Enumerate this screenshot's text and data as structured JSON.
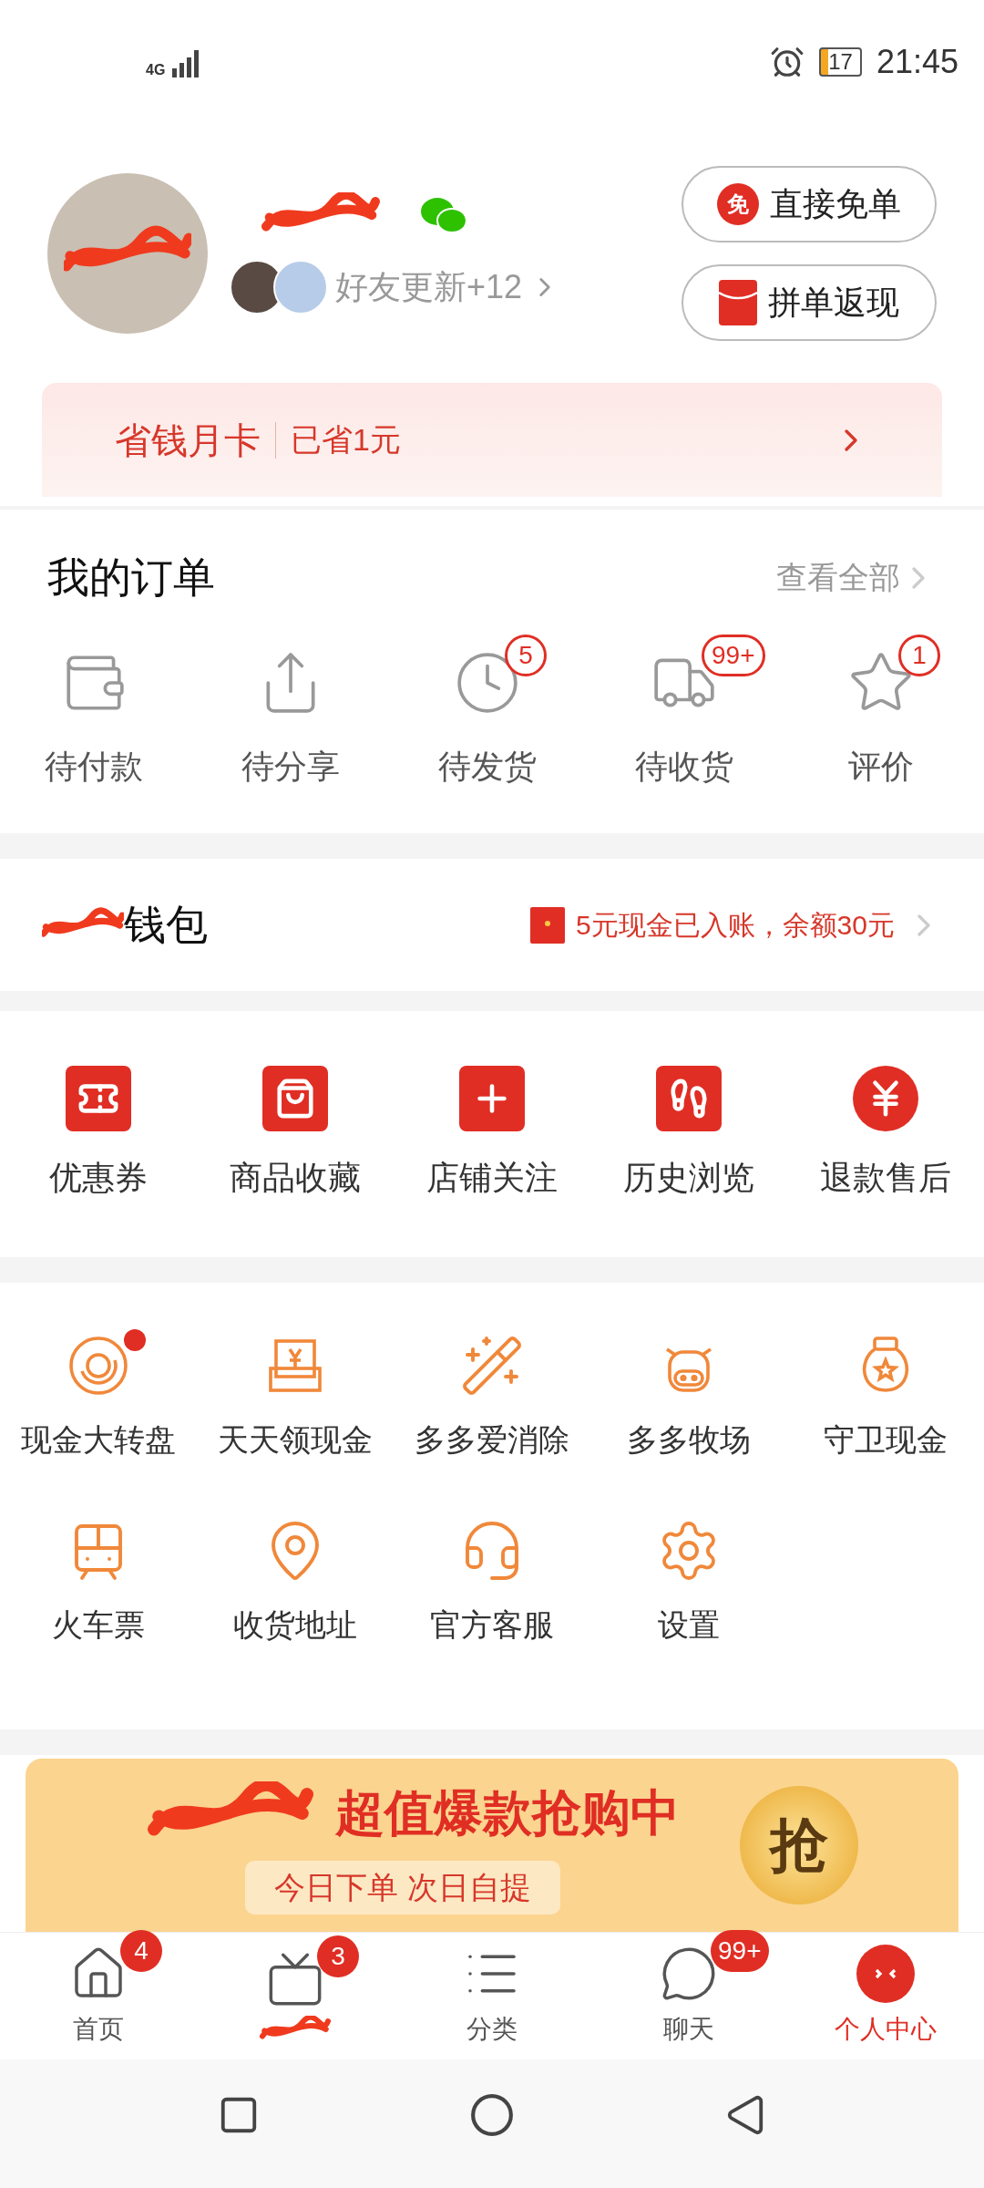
{
  "status_bar": {
    "time": "21:45",
    "battery": "17",
    "network": "4G"
  },
  "profile": {
    "friends_update": "好友更新+12",
    "buttons": [
      {
        "label": "直接免单",
        "badge": "免"
      },
      {
        "label": "拼单返现"
      }
    ]
  },
  "savings_card": {
    "title": "省钱月卡",
    "saved": "已省1元"
  },
  "orders": {
    "title": "我的订单",
    "view_all": "查看全部",
    "items": [
      {
        "label": "待付款"
      },
      {
        "label": "待分享"
      },
      {
        "label": "待发货",
        "count": "5"
      },
      {
        "label": "待收货",
        "count": "99+"
      },
      {
        "label": "评价",
        "count": "1"
      }
    ]
  },
  "wallet": {
    "title": "钱包",
    "notice": "5元现金已入账，余额30元"
  },
  "shortcuts": [
    {
      "label": "优惠券"
    },
    {
      "label": "商品收藏"
    },
    {
      "label": "店铺关注"
    },
    {
      "label": "历史浏览"
    },
    {
      "label": "退款售后"
    }
  ],
  "tools": [
    {
      "label": "现金大转盘",
      "dot": true
    },
    {
      "label": "天天领现金",
      "dot": false
    },
    {
      "label": "多多爱消除",
      "dot": false
    },
    {
      "label": "多多牧场",
      "dot": false
    },
    {
      "label": "守卫现金",
      "dot": false
    },
    {
      "label": "火车票",
      "dot": false
    },
    {
      "label": "收货地址",
      "dot": false
    },
    {
      "label": "官方客服",
      "dot": false
    },
    {
      "label": "设置",
      "dot": false
    }
  ],
  "banner": {
    "title": "超值爆款抢购中",
    "subtitle": "今日下单 次日自提",
    "button": "抢"
  },
  "tab_bar": [
    {
      "label": "首页",
      "count": "4",
      "selected": false
    },
    {
      "count": "3",
      "selected": false
    },
    {
      "label": "分类",
      "selected": false
    },
    {
      "label": "聊天",
      "count": "99+",
      "selected": false
    },
    {
      "label": "个人中心",
      "selected": true
    }
  ]
}
